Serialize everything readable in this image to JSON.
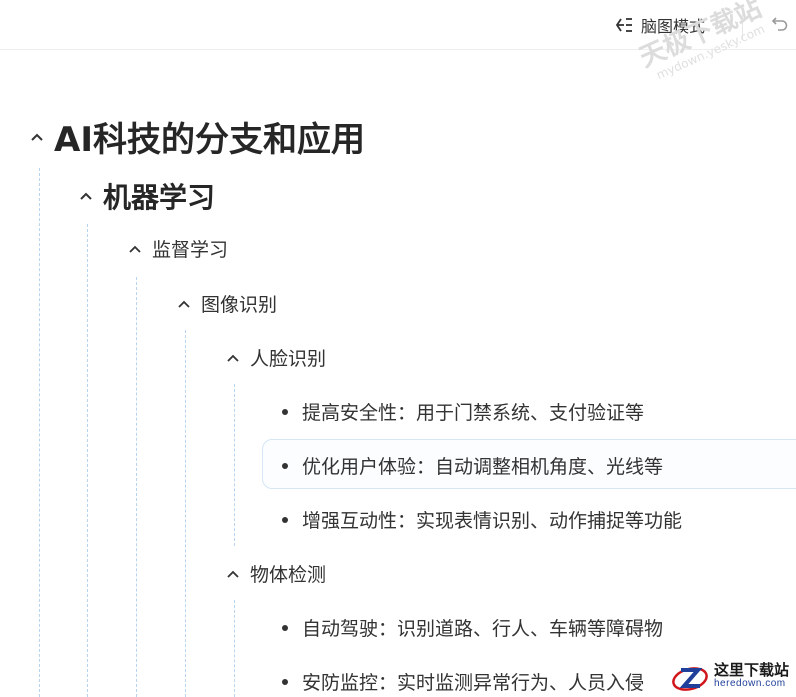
{
  "toolbar": {
    "mindmap_label": "脑图模式",
    "mindmap_icon": "mindmap-icon",
    "undo_icon": "undo-icon"
  },
  "watermark": {
    "main": "天极下载站",
    "sub": "mydown.yesky.com"
  },
  "logo": {
    "main": "这里下载站",
    "sub": "heredown.com",
    "accent": "#d0161b",
    "blue": "#1f3f9a"
  },
  "outline": {
    "root": "AI科技的分支和应用",
    "branch": "机器学习",
    "sub": "监督学习",
    "topic": "图像识别",
    "face": {
      "title": "人脸识别",
      "items": [
        "提高安全性：用于门禁系统、支付验证等",
        "优化用户体验：自动调整相机角度、光线等",
        "增强互动性：实现表情识别、动作捕捉等功能"
      ]
    },
    "object": {
      "title": "物体检测",
      "items": [
        "自动驾驶：识别道路、行人、车辆等障碍物",
        "安防监控：实时监测异常行为、人员入侵"
      ]
    }
  },
  "colors": {
    "guide": "#b9d4ee",
    "text": "#333333",
    "heading": "#262626"
  }
}
